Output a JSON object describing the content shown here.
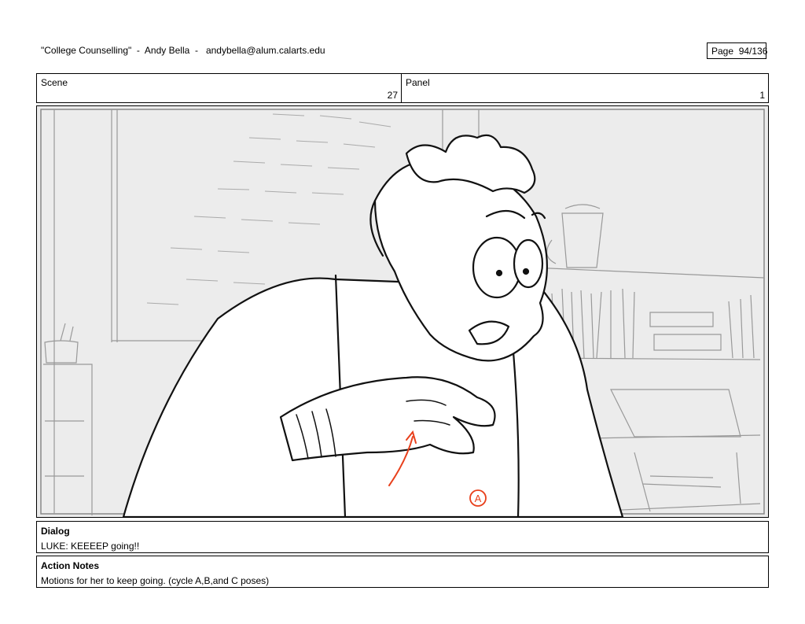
{
  "header": {
    "title": "\"College Counselling\"  -  Andy Bella  -   andybella@alum.calarts.edu",
    "page": "Page  94/136"
  },
  "scene": {
    "label": "Scene",
    "value": "27"
  },
  "panel": {
    "label": "Panel",
    "value": "1"
  },
  "artwork": {
    "annotation": "A",
    "annotation_color": "#e8401c"
  },
  "dialog": {
    "label": "Dialog",
    "text": "LUKE: KEEEEP going!!"
  },
  "action_notes": {
    "label": "Action Notes",
    "text": "Motions for her to keep going. (cycle A,B,and C poses)"
  }
}
